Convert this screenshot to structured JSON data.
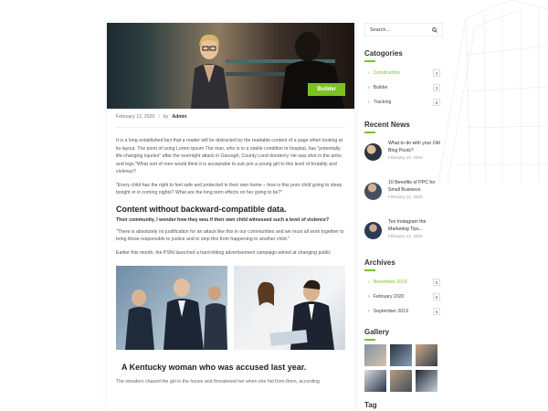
{
  "article": {
    "badge": "Builder",
    "date": "February 12, 2020",
    "separator": "/",
    "by": "by",
    "author": "Admin",
    "para1": "It is a long established fact that a reader will be distracted by the readable content of a page when looking at its layout. The point of using Lorem Ipsum The man, who is in a stable condition in hospital, has \"potentially life-changing injuries\" after the overnight attack in Garvagh, County Lond donderry. He was shot in the arms and legs.\"What sort of men would think it is acceptable to sub ject a young girl to this level of brutality and violence?",
    "para2": "\"Every child has the right to feel safe and protected in their own home – how is this poor child going to sleep tonight or in coming nights? What are the long term effects on her going to be?\"",
    "heading1": "Content without backward-compatible data.",
    "lead1": "Their community, I wonder how they wou if their own child witnessed such a level of violence?",
    "para3": "\"There is absolutely no justification for an attack like this in our communities and we must all work together to bring those responsible to justice and to stop this from happening to another child.\"",
    "para4": "Earlier this month, the PSNI launched a hard-hitting advertisement campaign aimed at changing public",
    "heading2": "A Kentucky woman who was accused last year.",
    "tail": "The intruders chased the girl in the house and threatened her when she hid from them, according"
  },
  "sidebar": {
    "search_placeholder": "Search...",
    "categories_title": "Catogories",
    "categories": [
      {
        "label": "Construction",
        "count": "3",
        "active": true
      },
      {
        "label": "Builder",
        "count": "3",
        "active": false
      },
      {
        "label": "Tracking",
        "count": "8",
        "active": false
      }
    ],
    "news_title": "Recent News",
    "news": [
      {
        "title": "What to do with your Old Blog Posts?",
        "date": "February 12, 2020"
      },
      {
        "title": "10 Benefits of PPC for Small Business",
        "date": "February 12, 2020"
      },
      {
        "title": "Ten Instagram the Marketing Tips...",
        "date": "February 12, 2020"
      }
    ],
    "archives_title": "Archives",
    "archives": [
      {
        "label": "November 2019",
        "count": "5",
        "active": true
      },
      {
        "label": "February 2020",
        "count": "6",
        "active": false
      },
      {
        "label": "September 2019",
        "count": "6",
        "active": false
      }
    ],
    "gallery_title": "Gallery",
    "tag_title": "Tag"
  },
  "colors": {
    "accent": "#7cc222"
  },
  "icons": {
    "search": "search-icon",
    "chevron": "chevron-right-icon"
  }
}
